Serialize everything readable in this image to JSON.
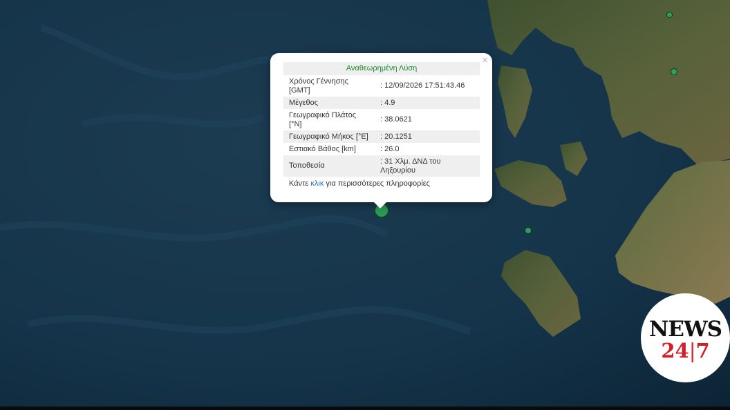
{
  "popup": {
    "title": "Αναθεωρημένη Λύση",
    "close_label": "×",
    "rows": [
      {
        "key": "Χρόνος Γέννησης [GMT]",
        "value": ": 12/09/2026 17:51:43.46"
      },
      {
        "key": "Μέγεθος",
        "value": ": 4.9"
      },
      {
        "key": "Γεωγραφικό Πλάτος [°N]",
        "value": ": 38.0621"
      },
      {
        "key": "Γεωγραφικό Μήκος [°E]",
        "value": ": 20.1251"
      },
      {
        "key": "Εστιακό Βάθος [km]",
        "value": ": 26.0"
      },
      {
        "key": "Τοποθεσία",
        "value": ": 31 Χλμ. ΔΝΔ του Ληξουρίου"
      }
    ],
    "footer_prefix": "Κάντε ",
    "footer_link": "κλικ",
    "footer_suffix": " για περισσότερες πληροφορίες"
  },
  "logo": {
    "word": "NEWS",
    "number_left": "24",
    "number_right": "7"
  },
  "colors": {
    "sea": "#0f2d42",
    "land": "#4a5a36",
    "marker": "#2e9e58",
    "popup_title": "#1a8a2a",
    "link": "#1f6fbf",
    "logo_red": "#d32027"
  },
  "icons": {
    "marker": "earthquake-marker-icon",
    "close": "close-icon"
  }
}
